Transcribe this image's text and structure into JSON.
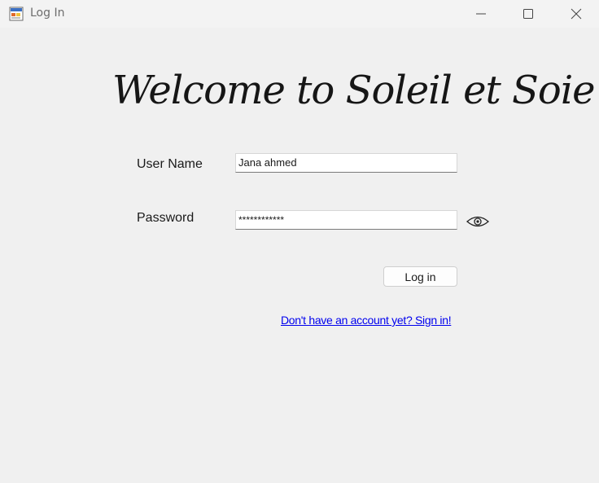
{
  "window": {
    "title": "Log In"
  },
  "heading": "Welcome to Soleil et Soie",
  "form": {
    "username_label": "User Name",
    "username_value": "Jana ahmed",
    "password_label": "Password",
    "password_value": "************",
    "show_password_icon": "eye-icon",
    "login_label": "Log in",
    "signup_link": "Don't have an account yet? Sign in!"
  },
  "colors": {
    "window_bg": "#f0f0f0",
    "link": "#0000ee"
  }
}
